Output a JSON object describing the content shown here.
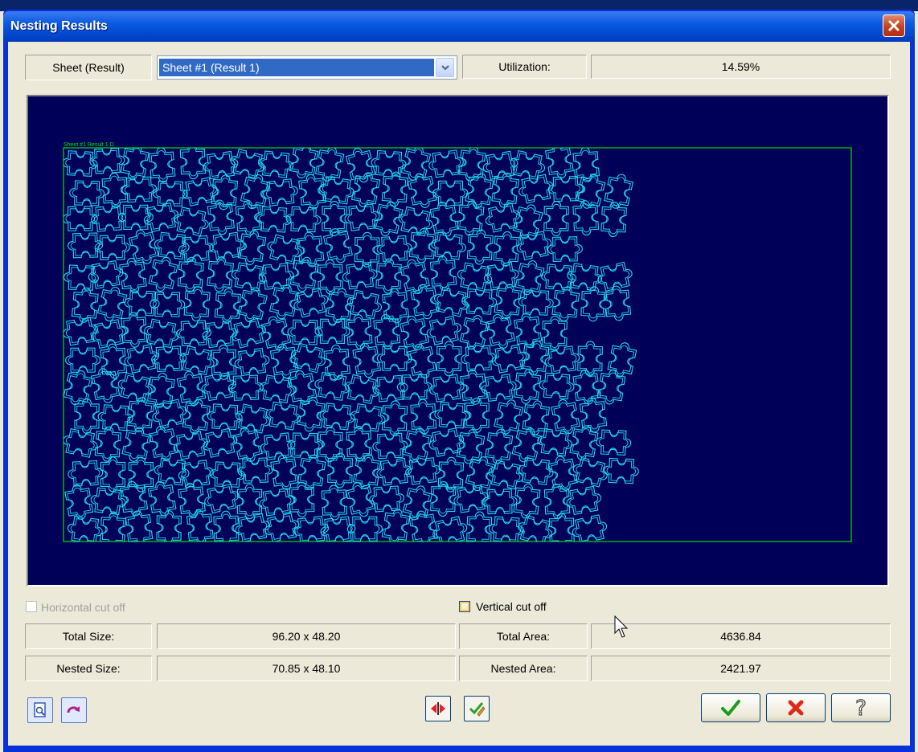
{
  "window": {
    "title": "Nesting Results"
  },
  "sheet": {
    "label": "Sheet (Result)",
    "selected": "Sheet #1 (Result 1)"
  },
  "utilization": {
    "label": "Utilization:",
    "value": "14.59%"
  },
  "preview": {
    "sheet_label": "Sheet #1 Result 1 D"
  },
  "options": {
    "horizontal_cut_off": "Horizontal cut off",
    "vertical_cut_off": "Vertical cut off"
  },
  "stats": {
    "total_size_label": "Total Size:",
    "total_size": "96.20 x 48.20",
    "nested_size_label": "Nested Size:",
    "nested_size": "70.85 x 48.10",
    "total_area_label": "Total Area:",
    "total_area": "4636.84",
    "nested_area_label": "Nested Area:",
    "nested_area": "2421.97"
  },
  "icons": [
    "close-icon",
    "dropdown-arrow-icon",
    "zoom-page-icon",
    "redo-arrow-icon",
    "flip-icon",
    "check-pencil-icon",
    "ok-check-icon",
    "cancel-x-icon",
    "help-question-icon",
    "mouse-cursor-icon"
  ],
  "colors": {
    "canvas_bg": "#000058",
    "sheet_border": "#00e000",
    "parts": "#22d8f2",
    "titlebar": "#0a5ae0"
  }
}
